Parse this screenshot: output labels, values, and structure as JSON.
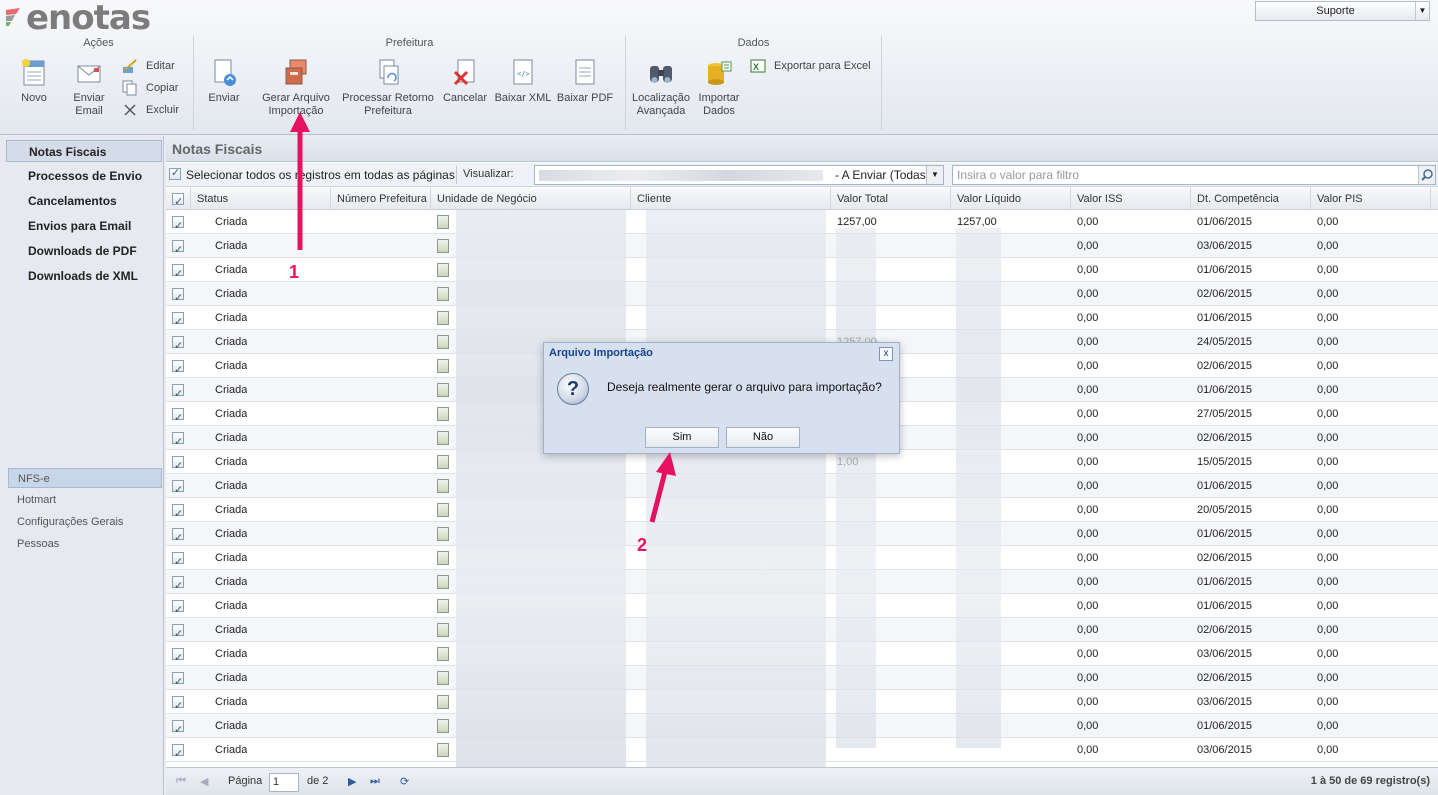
{
  "header": {
    "logo_text": "enotas",
    "support_label": "Suporte"
  },
  "ribbon": {
    "groups": {
      "acoes": "Ações",
      "prefeitura": "Prefeitura",
      "dados": "Dados"
    },
    "buttons": {
      "novo": "Novo",
      "enviar_email_1": "Enviar",
      "enviar_email_2": "Email",
      "editar": "Editar",
      "copiar": "Copiar",
      "excluir": "Excluir",
      "enviar": "Enviar",
      "gerar_1": "Gerar Arquivo",
      "gerar_2": "Importação",
      "processar_1": "Processar Retorno",
      "processar_2": "Prefeitura",
      "cancelar": "Cancelar",
      "baixar_xml": "Baixar XML",
      "baixar_pdf": "Baixar PDF",
      "localizacao_1": "Localização",
      "localizacao_2": "Avançada",
      "importar_1": "Importar",
      "importar_2": "Dados",
      "exportar_excel": "Exportar para Excel"
    }
  },
  "leftnav": {
    "items": [
      "Notas Fiscais",
      "Processos de Envio",
      "Cancelamentos",
      "Envios para Email",
      "Downloads de PDF",
      "Downloads de XML"
    ],
    "modules": [
      "NFS-e",
      "Hotmart",
      "Configurações Gerais",
      "Pessoas"
    ]
  },
  "main": {
    "title": "Notas Fiscais",
    "select_all": "Selecionar todos os registros em todas as páginas",
    "visualizar_label": "Visualizar:",
    "visualizar_value": "- A Enviar (Todas)",
    "filter_placeholder": "Insira o valor para filtro"
  },
  "grid": {
    "columns": [
      "Status",
      "Número Prefeitura",
      "Unidade de Negócio",
      "Cliente",
      "Valor Total",
      "Valor Líquido",
      "Valor ISS",
      "Dt. Competência",
      "Valor PIS"
    ],
    "rows": [
      {
        "status": "Criada",
        "iss": "0,00",
        "dt": "01/06/2015",
        "pis": "0,00",
        "total": "1257,00",
        "liquido": "1257,00"
      },
      {
        "status": "Criada",
        "iss": "0,00",
        "dt": "03/06/2015",
        "pis": "0,00",
        "total": "",
        "liquido": ""
      },
      {
        "status": "Criada",
        "iss": "0,00",
        "dt": "01/06/2015",
        "pis": "0,00",
        "total": "",
        "liquido": ""
      },
      {
        "status": "Criada",
        "iss": "0,00",
        "dt": "02/06/2015",
        "pis": "0,00",
        "total": "",
        "liquido": ""
      },
      {
        "status": "Criada",
        "iss": "0,00",
        "dt": "01/06/2015",
        "pis": "0,00",
        "total": "",
        "liquido": ""
      },
      {
        "status": "Criada",
        "iss": "0,00",
        "dt": "24/05/2015",
        "pis": "0,00",
        "total": "1257,00",
        "liquido": ""
      },
      {
        "status": "Criada",
        "iss": "0,00",
        "dt": "02/06/2015",
        "pis": "0,00",
        "total": "",
        "liquido": ""
      },
      {
        "status": "Criada",
        "iss": "0,00",
        "dt": "01/06/2015",
        "pis": "0,00",
        "total": "",
        "liquido": ""
      },
      {
        "status": "Criada",
        "iss": "0,00",
        "dt": "27/05/2015",
        "pis": "0,00",
        "total": "",
        "liquido": ""
      },
      {
        "status": "Criada",
        "iss": "0,00",
        "dt": "02/06/2015",
        "pis": "0,00",
        "total": "",
        "liquido": ""
      },
      {
        "status": "Criada",
        "iss": "0,00",
        "dt": "15/05/2015",
        "pis": "0,00",
        "total": "1,00",
        "liquido": ""
      },
      {
        "status": "Criada",
        "iss": "0,00",
        "dt": "01/06/2015",
        "pis": "0,00",
        "total": "",
        "liquido": ""
      },
      {
        "status": "Criada",
        "iss": "0,00",
        "dt": "20/05/2015",
        "pis": "0,00",
        "total": "",
        "liquido": ""
      },
      {
        "status": "Criada",
        "iss": "0,00",
        "dt": "01/06/2015",
        "pis": "0,00",
        "total": "",
        "liquido": ""
      },
      {
        "status": "Criada",
        "iss": "0,00",
        "dt": "02/06/2015",
        "pis": "0,00",
        "total": "",
        "liquido": ""
      },
      {
        "status": "Criada",
        "iss": "0,00",
        "dt": "01/06/2015",
        "pis": "0,00",
        "total": "",
        "liquido": ""
      },
      {
        "status": "Criada",
        "iss": "0,00",
        "dt": "01/06/2015",
        "pis": "0,00",
        "total": "",
        "liquido": ""
      },
      {
        "status": "Criada",
        "iss": "0,00",
        "dt": "02/06/2015",
        "pis": "0,00",
        "total": "",
        "liquido": ""
      },
      {
        "status": "Criada",
        "iss": "0,00",
        "dt": "03/06/2015",
        "pis": "0,00",
        "total": "",
        "liquido": ""
      },
      {
        "status": "Criada",
        "iss": "0,00",
        "dt": "02/06/2015",
        "pis": "0,00",
        "total": "",
        "liquido": ""
      },
      {
        "status": "Criada",
        "iss": "0,00",
        "dt": "03/06/2015",
        "pis": "0,00",
        "total": "",
        "liquido": ""
      },
      {
        "status": "Criada",
        "iss": "0,00",
        "dt": "01/06/2015",
        "pis": "0,00",
        "total": "",
        "liquido": ""
      },
      {
        "status": "Criada",
        "iss": "0,00",
        "dt": "03/06/2015",
        "pis": "0,00",
        "total": "",
        "liquido": ""
      }
    ]
  },
  "pager": {
    "page_label": "Página",
    "page_value": "1",
    "of_label": "de 2",
    "count": "1 à 50 de 69 registro(s)"
  },
  "dialog": {
    "title": "Arquivo Importação",
    "close": "x",
    "message": "Deseja realmente gerar o arquivo para importação?",
    "yes": "Sim",
    "no": "Não"
  },
  "annotations": {
    "step1": "1",
    "step2": "2",
    "color": "#e5125f"
  }
}
